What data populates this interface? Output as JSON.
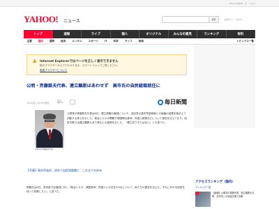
{
  "topbar": {
    "links": [
      "Yahoo! JAPAN",
      "ヘルプ"
    ]
  },
  "header": {
    "logo": "YAHOO!",
    "logo_sub": "ニュース",
    "search_placeholder": "",
    "search_button": "検索",
    "links": [
      "ログイン",
      "ヘルプ"
    ]
  },
  "gnav": {
    "items": [
      {
        "label": "トップ",
        "active": true
      },
      {
        "label": "速報",
        "active": false
      },
      {
        "label": "ライブ",
        "active": false
      },
      {
        "label": "個人",
        "active": false
      },
      {
        "label": "オリジナル",
        "active": false
      },
      {
        "label": "みんなの意見",
        "active": false
      },
      {
        "label": "ランキング",
        "active": false
      },
      {
        "label": "有料",
        "active": false
      }
    ]
  },
  "subnav": {
    "items": [
      {
        "label": "主要",
        "active": false
      },
      {
        "label": "国内",
        "active": true
      },
      {
        "label": "国際",
        "active": false
      },
      {
        "label": "経済",
        "active": false
      },
      {
        "label": "エンタメ",
        "active": false
      },
      {
        "label": "スポーツ",
        "active": false
      },
      {
        "label": "IT",
        "active": false
      },
      {
        "label": "科学",
        "active": false
      },
      {
        "label": "ライフ",
        "active": false
      },
      {
        "label": "地域",
        "active": false
      }
    ],
    "topics": "トピックス一覧"
  },
  "notice": {
    "title": "Internet Explorerではページを正しく表示できません",
    "body": "他のブラウザーからアクセスするか、スマートフォンでご覧ください。",
    "link": "推奨ブラウザーについて"
  },
  "article": {
    "headline": "公明・斉藤鉄夫代表、連立離脱はあわせず　高市氏の自民総裁就任に",
    "date": "10/6(月) 19:06 配信",
    "comment_count": "2",
    "more": "…",
    "source": "毎日新聞",
    "photo_caption": "公明党の斉藤鉄夫代表",
    "body": "公明党の斉藤鉄夫代表は6日、連立政権の継続について、自民党の高市早苗総裁との協議の結果を踏まえて判断する考えを示した。政治とカネの問題や靖国神社参拝、外国人政策などについて懸念を伝えており、回答次第では連立離脱もあり得るとの姿勢を示した。「連立ありきではない」とも述べた。",
    "related": "【写真】高市早苗氏、初めて自民党総裁に　これまでの歩み",
    "para2": "斉藤氏は6日、党本部で記者団に対し「政治とカネ、靖国参拝、外国人との共生の3点について、私たちの懸念を伝えた。それに対する回答を待って判断したい」と述べた。"
  },
  "sidebar": {
    "ranking_title": "アクセスランキング（国内）",
    "ranking_sub": "ランキング一覧",
    "item1_rank": "1",
    "item1_text": "【速報】公明党の斉藤代表、連立離脱を示唆　高市氏との協議次第で判断"
  }
}
